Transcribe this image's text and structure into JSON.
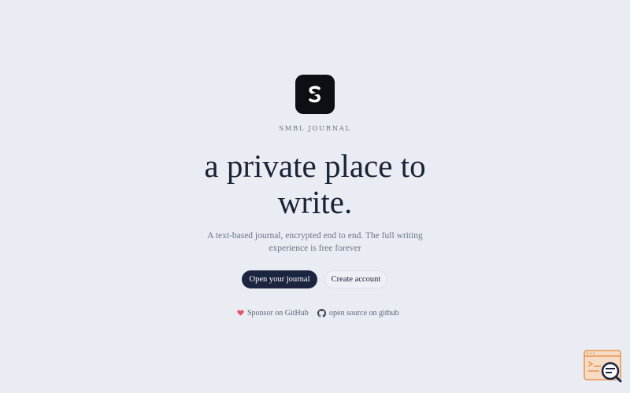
{
  "brand": {
    "name": "SMBL JOURNAL",
    "logo_icon": "s-logo-icon"
  },
  "hero": {
    "headline_line1": "a private place to",
    "headline_line2": "write.",
    "subtitle_line1": "A text-based journal, encrypted end to end. The full writing",
    "subtitle_line2": "experience is free forever"
  },
  "actions": {
    "open_journal": "Open your journal",
    "create_account": "Create account"
  },
  "links": {
    "sponsor": "Sponsor on GitHub",
    "sponsor_icon": "heart-icon",
    "github": "open source on github",
    "github_icon": "github-icon"
  },
  "colors": {
    "background": "#e9ecf2",
    "primary_button": "#1c2540",
    "heading": "#1c2336",
    "heart": "#e25567"
  }
}
